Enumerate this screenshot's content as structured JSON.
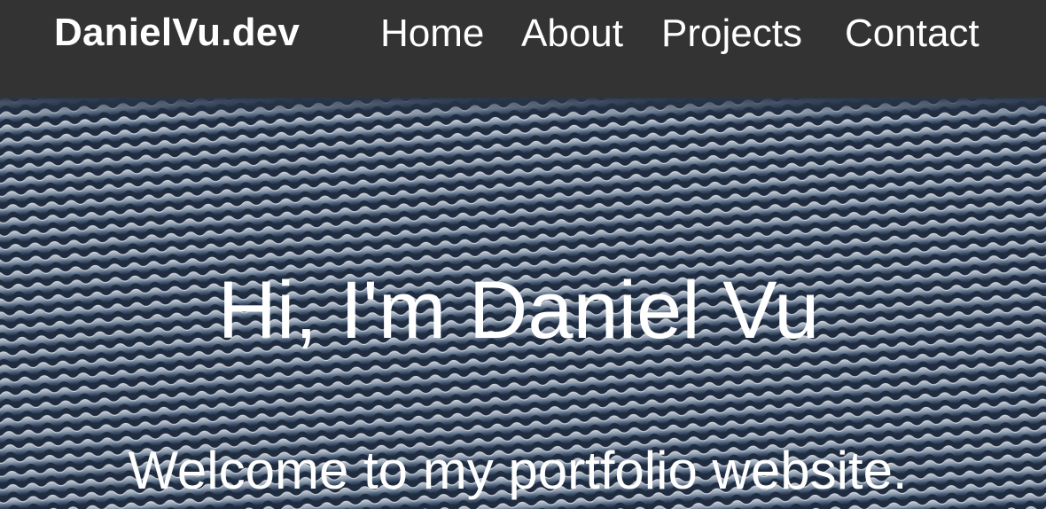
{
  "header": {
    "brand": "DanielVu.dev",
    "nav": [
      {
        "label": "Home"
      },
      {
        "label": "About"
      },
      {
        "label": "Projects"
      },
      {
        "label": "Contact"
      }
    ]
  },
  "hero": {
    "title": "Hi, I'm Daniel Vu",
    "subtitle": "Welcome to my portfolio website.",
    "background": "roof-tiles-image"
  },
  "colors": {
    "navbar_bg": "#333333",
    "text": "#ffffff"
  }
}
